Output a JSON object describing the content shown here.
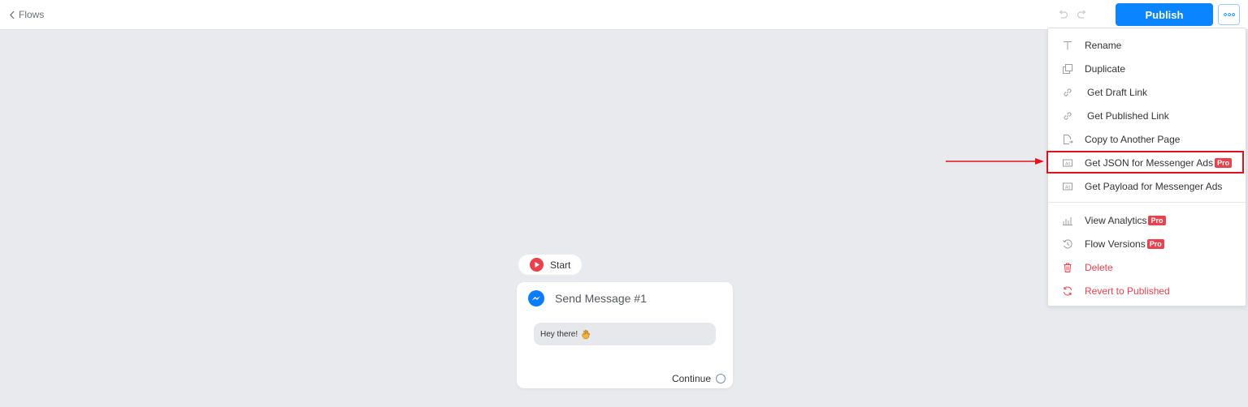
{
  "topbar": {
    "back_label": "Flows",
    "publish_label": "Publish"
  },
  "menu": {
    "items": [
      {
        "label": "Rename",
        "icon": "text-icon"
      },
      {
        "label": "Duplicate",
        "icon": "duplicate-icon"
      },
      {
        "label": "Get Draft Link",
        "icon": "link-icon"
      },
      {
        "label": "Get Published Link",
        "icon": "link-icon"
      },
      {
        "label": "Copy to Another Page",
        "icon": "copy-to-page-icon"
      },
      {
        "label": "Get JSON for Messenger Ads",
        "icon": "ad-icon",
        "badge": "Pro"
      },
      {
        "label": "Get Payload for Messenger Ads",
        "icon": "ad-icon"
      },
      {
        "label": "View Analytics",
        "icon": "analytics-icon",
        "badge": "Pro"
      },
      {
        "label": "Flow Versions",
        "icon": "history-icon",
        "badge": "Pro"
      },
      {
        "label": "Delete",
        "icon": "trash-icon"
      },
      {
        "label": "Revert to Published",
        "icon": "revert-icon"
      }
    ]
  },
  "canvas": {
    "start_label": "Start",
    "card_title": "Send Message #1",
    "message_text": "Hey there!",
    "continue_label": "Continue"
  },
  "colors": {
    "accent": "#0a84ff",
    "danger": "#e8424f",
    "highlight": "#e3121f",
    "canvas_bg": "#e9eaed"
  }
}
